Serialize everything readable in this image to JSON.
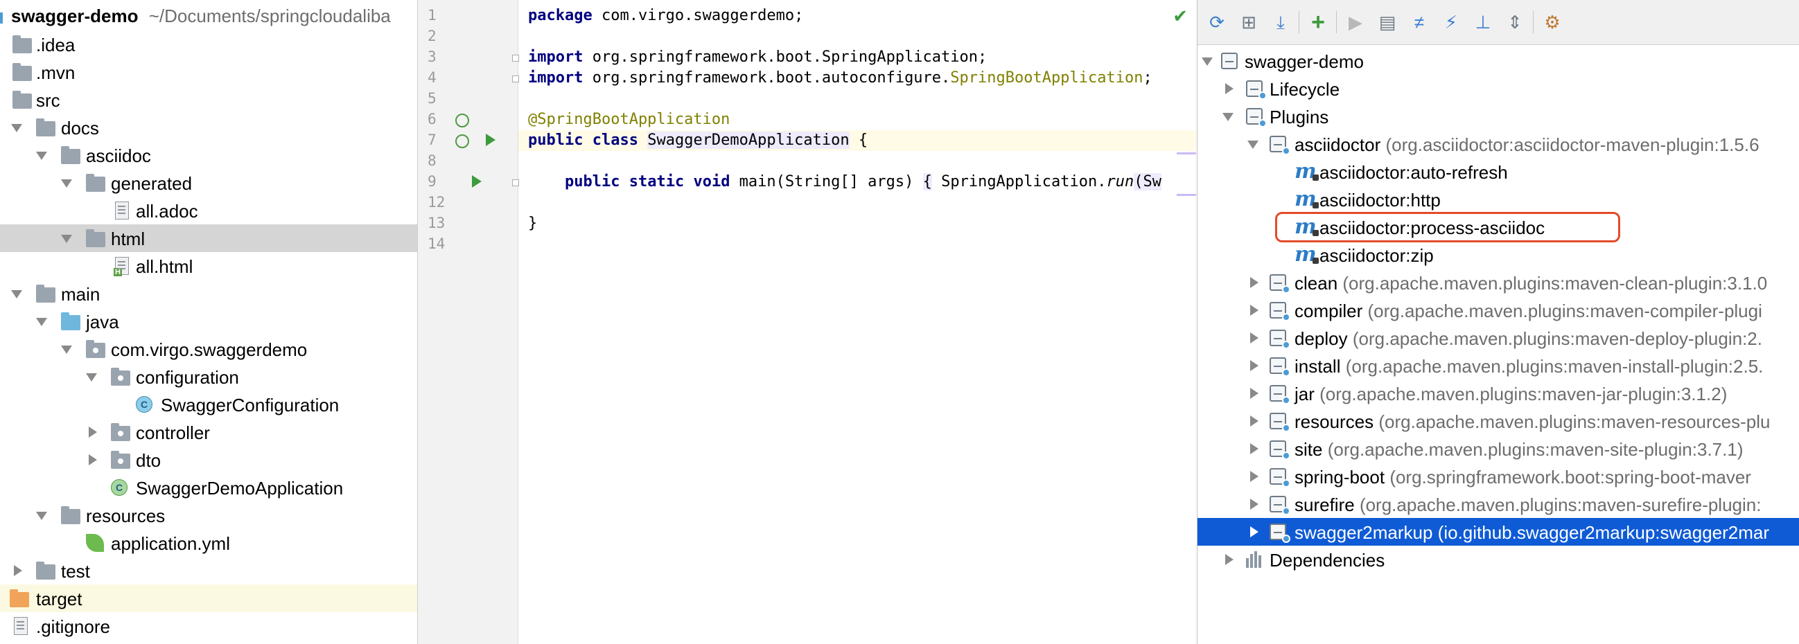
{
  "project_tree": {
    "root": {
      "name": "swagger-demo",
      "path": "~/Documents/springcloudaliba"
    },
    "items": [
      {
        "label": "",
        "name": ".idea"
      },
      {
        "name": ".mvn"
      },
      {
        "name": "src"
      },
      {
        "name": "docs"
      },
      {
        "name": "asciidoc"
      },
      {
        "name": "generated"
      },
      {
        "name": "all.adoc"
      },
      {
        "name": "html"
      },
      {
        "name": "all.html"
      },
      {
        "name": "main"
      },
      {
        "name": "java"
      },
      {
        "name": "com.virgo.swaggerdemo"
      },
      {
        "name": "configuration"
      },
      {
        "name": "SwaggerConfiguration"
      },
      {
        "name": "controller"
      },
      {
        "name": "dto"
      },
      {
        "name": "SwaggerDemoApplication"
      },
      {
        "name": "resources"
      },
      {
        "name": "application.yml"
      },
      {
        "name": "test"
      },
      {
        "name": "target"
      },
      {
        "name": ".gitignore"
      }
    ]
  },
  "editor": {
    "line_numbers": [
      "1",
      "2",
      "3",
      "4",
      "5",
      "6",
      "7",
      "8",
      "9",
      "12",
      "13",
      "14"
    ],
    "line1": {
      "kw": "package",
      "rest": " com.virgo.swaggerdemo;"
    },
    "line3": {
      "kw": "import",
      "rest": " org.springframework.boot.SpringApplication;"
    },
    "line4": {
      "kw": "import",
      "rest": " org.springframework.boot.autoconfigure.",
      "anno": "SpringBootApplication",
      "end": ";"
    },
    "line6": {
      "anno": "@SpringBootApplication"
    },
    "line7": {
      "kw1": "public",
      "kw2": "class",
      "cls": "SwaggerDemoApplication",
      "end": " {"
    },
    "line9": {
      "indent": "    ",
      "kw1": "public",
      "kw2": "static",
      "kw3": "void",
      "mid": " main(String[] args) ",
      "brace": "{",
      "pre": " SpringApplication.",
      "call": "run",
      "post": "(Sw"
    },
    "line12": {
      "text": "}"
    },
    "status": "✔"
  },
  "maven": {
    "toolbar": [
      {
        "name": "reimport-icon",
        "glyph": "⟳",
        "color": "#3b7fd0"
      },
      {
        "name": "generate-sources-icon",
        "glyph": "⊞",
        "color": "#6e7a85"
      },
      {
        "name": "download-icon",
        "glyph": "⤓",
        "color": "#3b7fd0"
      },
      {
        "name": "add-icon",
        "glyph": "+",
        "color": "#3d9b3d"
      },
      {
        "name": "run-icon",
        "glyph": "▶",
        "color": "#b8b8b8"
      },
      {
        "name": "execute-goal-icon",
        "glyph": "▤",
        "color": "#6e7a85"
      },
      {
        "name": "toggle-offline-icon",
        "glyph": "≠",
        "color": "#3b7fd0"
      },
      {
        "name": "skip-tests-icon",
        "glyph": "⚡",
        "color": "#3b7fd0"
      },
      {
        "name": "show-dependencies-icon",
        "glyph": "⊥",
        "color": "#3b7fd0"
      },
      {
        "name": "collapse-all-icon",
        "glyph": "⇕",
        "color": "#6e7a85"
      },
      {
        "name": "settings-icon",
        "glyph": "⚙",
        "color": "#c0782f"
      }
    ],
    "root": "swagger-demo",
    "lifecycle": "Lifecycle",
    "plugins_label": "Plugins",
    "asciidoctor": {
      "name": "asciidoctor",
      "coord": "(org.asciidoctor:asciidoctor-maven-plugin:1.5.6"
    },
    "goals": [
      "asciidoctor:auto-refresh",
      "asciidoctor:http",
      "asciidoctor:process-asciidoc",
      "asciidoctor:zip"
    ],
    "plugins": [
      {
        "name": "clean",
        "coord": "(org.apache.maven.plugins:maven-clean-plugin:3.1.0"
      },
      {
        "name": "compiler",
        "coord": "(org.apache.maven.plugins:maven-compiler-plugi"
      },
      {
        "name": "deploy",
        "coord": "(org.apache.maven.plugins:maven-deploy-plugin:2."
      },
      {
        "name": "install",
        "coord": "(org.apache.maven.plugins:maven-install-plugin:2.5."
      },
      {
        "name": "jar",
        "coord": "(org.apache.maven.plugins:maven-jar-plugin:3.1.2)"
      },
      {
        "name": "resources",
        "coord": "(org.apache.maven.plugins:maven-resources-plu"
      },
      {
        "name": "site",
        "coord": "(org.apache.maven.plugins:maven-site-plugin:3.7.1)"
      },
      {
        "name": "spring-boot",
        "coord": "(org.springframework.boot:spring-boot-maver"
      },
      {
        "name": "surefire",
        "coord": "(org.apache.maven.plugins:maven-surefire-plugin:"
      },
      {
        "name": "swagger2markup",
        "coord": "(io.github.swagger2markup:swagger2mar"
      }
    ],
    "dependencies": "Dependencies"
  },
  "colors": {
    "selection_blue": "#0f5bd6",
    "highlight_box": "#e24b2c",
    "keyword": "#000080",
    "annotation": "#808000"
  }
}
